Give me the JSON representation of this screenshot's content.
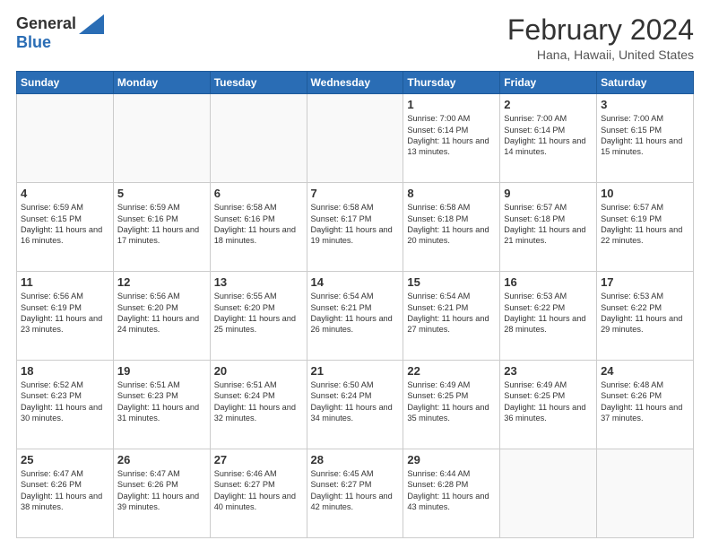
{
  "header": {
    "logo": {
      "general": "General",
      "blue": "Blue"
    },
    "title": "February 2024",
    "subtitle": "Hana, Hawaii, United States"
  },
  "days_of_week": [
    "Sunday",
    "Monday",
    "Tuesday",
    "Wednesday",
    "Thursday",
    "Friday",
    "Saturday"
  ],
  "weeks": [
    [
      {
        "day": "",
        "info": ""
      },
      {
        "day": "",
        "info": ""
      },
      {
        "day": "",
        "info": ""
      },
      {
        "day": "",
        "info": ""
      },
      {
        "day": "1",
        "info": "Sunrise: 7:00 AM\nSunset: 6:14 PM\nDaylight: 11 hours and 13 minutes."
      },
      {
        "day": "2",
        "info": "Sunrise: 7:00 AM\nSunset: 6:14 PM\nDaylight: 11 hours and 14 minutes."
      },
      {
        "day": "3",
        "info": "Sunrise: 7:00 AM\nSunset: 6:15 PM\nDaylight: 11 hours and 15 minutes."
      }
    ],
    [
      {
        "day": "4",
        "info": "Sunrise: 6:59 AM\nSunset: 6:15 PM\nDaylight: 11 hours and 16 minutes."
      },
      {
        "day": "5",
        "info": "Sunrise: 6:59 AM\nSunset: 6:16 PM\nDaylight: 11 hours and 17 minutes."
      },
      {
        "day": "6",
        "info": "Sunrise: 6:58 AM\nSunset: 6:16 PM\nDaylight: 11 hours and 18 minutes."
      },
      {
        "day": "7",
        "info": "Sunrise: 6:58 AM\nSunset: 6:17 PM\nDaylight: 11 hours and 19 minutes."
      },
      {
        "day": "8",
        "info": "Sunrise: 6:58 AM\nSunset: 6:18 PM\nDaylight: 11 hours and 20 minutes."
      },
      {
        "day": "9",
        "info": "Sunrise: 6:57 AM\nSunset: 6:18 PM\nDaylight: 11 hours and 21 minutes."
      },
      {
        "day": "10",
        "info": "Sunrise: 6:57 AM\nSunset: 6:19 PM\nDaylight: 11 hours and 22 minutes."
      }
    ],
    [
      {
        "day": "11",
        "info": "Sunrise: 6:56 AM\nSunset: 6:19 PM\nDaylight: 11 hours and 23 minutes."
      },
      {
        "day": "12",
        "info": "Sunrise: 6:56 AM\nSunset: 6:20 PM\nDaylight: 11 hours and 24 minutes."
      },
      {
        "day": "13",
        "info": "Sunrise: 6:55 AM\nSunset: 6:20 PM\nDaylight: 11 hours and 25 minutes."
      },
      {
        "day": "14",
        "info": "Sunrise: 6:54 AM\nSunset: 6:21 PM\nDaylight: 11 hours and 26 minutes."
      },
      {
        "day": "15",
        "info": "Sunrise: 6:54 AM\nSunset: 6:21 PM\nDaylight: 11 hours and 27 minutes."
      },
      {
        "day": "16",
        "info": "Sunrise: 6:53 AM\nSunset: 6:22 PM\nDaylight: 11 hours and 28 minutes."
      },
      {
        "day": "17",
        "info": "Sunrise: 6:53 AM\nSunset: 6:22 PM\nDaylight: 11 hours and 29 minutes."
      }
    ],
    [
      {
        "day": "18",
        "info": "Sunrise: 6:52 AM\nSunset: 6:23 PM\nDaylight: 11 hours and 30 minutes."
      },
      {
        "day": "19",
        "info": "Sunrise: 6:51 AM\nSunset: 6:23 PM\nDaylight: 11 hours and 31 minutes."
      },
      {
        "day": "20",
        "info": "Sunrise: 6:51 AM\nSunset: 6:24 PM\nDaylight: 11 hours and 32 minutes."
      },
      {
        "day": "21",
        "info": "Sunrise: 6:50 AM\nSunset: 6:24 PM\nDaylight: 11 hours and 34 minutes."
      },
      {
        "day": "22",
        "info": "Sunrise: 6:49 AM\nSunset: 6:25 PM\nDaylight: 11 hours and 35 minutes."
      },
      {
        "day": "23",
        "info": "Sunrise: 6:49 AM\nSunset: 6:25 PM\nDaylight: 11 hours and 36 minutes."
      },
      {
        "day": "24",
        "info": "Sunrise: 6:48 AM\nSunset: 6:26 PM\nDaylight: 11 hours and 37 minutes."
      }
    ],
    [
      {
        "day": "25",
        "info": "Sunrise: 6:47 AM\nSunset: 6:26 PM\nDaylight: 11 hours and 38 minutes."
      },
      {
        "day": "26",
        "info": "Sunrise: 6:47 AM\nSunset: 6:26 PM\nDaylight: 11 hours and 39 minutes."
      },
      {
        "day": "27",
        "info": "Sunrise: 6:46 AM\nSunset: 6:27 PM\nDaylight: 11 hours and 40 minutes."
      },
      {
        "day": "28",
        "info": "Sunrise: 6:45 AM\nSunset: 6:27 PM\nDaylight: 11 hours and 42 minutes."
      },
      {
        "day": "29",
        "info": "Sunrise: 6:44 AM\nSunset: 6:28 PM\nDaylight: 11 hours and 43 minutes."
      },
      {
        "day": "",
        "info": ""
      },
      {
        "day": "",
        "info": ""
      }
    ]
  ]
}
